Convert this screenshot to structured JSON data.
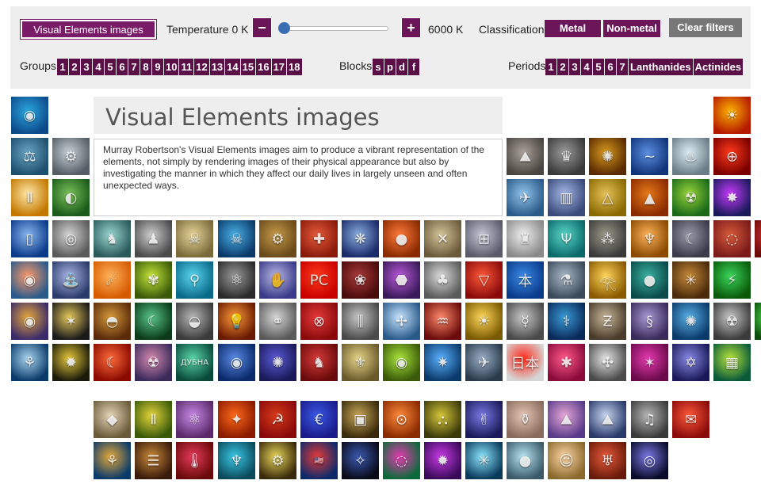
{
  "filters": {
    "ve_button": "Visual Elements images",
    "temperature_label": "Temperature 0 K",
    "minus": "−",
    "plus": "+",
    "temperature_max_label": "6000 K",
    "slider_value": 0,
    "classification_label": "Classification",
    "metal": "Metal",
    "nonmetal": "Non-metal",
    "clear": "Clear filters",
    "groups_label": "Groups",
    "groups": [
      "1",
      "2",
      "3",
      "4",
      "5",
      "6",
      "7",
      "8",
      "9",
      "10",
      "11",
      "12",
      "13",
      "14",
      "15",
      "16",
      "17",
      "18"
    ],
    "blocks_label": "Blocks",
    "blocks": [
      "s",
      "p",
      "d",
      "f"
    ],
    "periods_label": "Periods",
    "periods": [
      "1",
      "2",
      "3",
      "4",
      "5",
      "6",
      "7",
      "Lanthanides",
      "Actinides"
    ]
  },
  "info": {
    "title": "Visual Elements images",
    "description": "Murray Robertson's Visual Elements images aim to produce a vibrant representation of the elements, not simply by rendering images of their physical appearance but also by investigating the manner in which they affect our daily lives in largely unseen and often unexpected ways."
  },
  "tiles": [
    {
      "period": 1,
      "group": 1,
      "c1": "#0d4a8a",
      "c2": "#2aa7e0",
      "icon": "◉"
    },
    {
      "period": 1,
      "group": 18,
      "c1": "#b31a00",
      "c2": "#ffb300",
      "icon": "☀"
    },
    {
      "period": 2,
      "group": 1,
      "c1": "#1d4f6e",
      "c2": "#6aa6c4",
      "icon": "⚖"
    },
    {
      "period": 2,
      "group": 2,
      "c1": "#555e66",
      "c2": "#c9d1d8",
      "icon": "⚙"
    },
    {
      "period": 2,
      "group": 13,
      "c1": "#4a4540",
      "c2": "#a9a39a",
      "icon": "⛰"
    },
    {
      "period": 2,
      "group": 14,
      "c1": "#3a3a3a",
      "c2": "#9c9c9c",
      "icon": "♛"
    },
    {
      "period": 2,
      "group": 15,
      "c1": "#5a2a00",
      "c2": "#d79a20",
      "icon": "✺"
    },
    {
      "period": 2,
      "group": 16,
      "c1": "#12357a",
      "c2": "#5a8ee0",
      "icon": "~"
    },
    {
      "period": 2,
      "group": 17,
      "c1": "#6a7d88",
      "c2": "#dfeef5",
      "icon": "♨"
    },
    {
      "period": 2,
      "group": 18,
      "c1": "#7a0000",
      "c2": "#ff3a1a",
      "icon": "⊕"
    },
    {
      "period": 3,
      "group": 1,
      "c1": "#c47800",
      "c2": "#ffe9a8",
      "icon": "Ⅱ"
    },
    {
      "period": 3,
      "group": 2,
      "c1": "#1a5a1a",
      "c2": "#7ac25a",
      "icon": "◐"
    },
    {
      "period": 3,
      "group": 13,
      "c1": "#2a5a8a",
      "c2": "#8fc4ea",
      "icon": "✈"
    },
    {
      "period": 3,
      "group": 14,
      "c1": "#3a4a7a",
      "c2": "#a3b7e6",
      "icon": "▥"
    },
    {
      "period": 3,
      "group": 15,
      "c1": "#8a6a00",
      "c2": "#e6c25a",
      "icon": "△"
    },
    {
      "period": 3,
      "group": 16,
      "c1": "#8a2a00",
      "c2": "#e67a1a",
      "icon": "▲"
    },
    {
      "period": 3,
      "group": 17,
      "c1": "#1a6a1a",
      "c2": "#9ad63a",
      "icon": "☢"
    },
    {
      "period": 3,
      "group": 18,
      "c1": "#1a1a5a",
      "c2": "#c83aff",
      "icon": "✸"
    },
    {
      "period": 4,
      "group": 1,
      "c1": "#0a3a8a",
      "c2": "#8ab8f0",
      "icon": "▯"
    },
    {
      "period": 4,
      "group": 2,
      "c1": "#5a5a5a",
      "c2": "#d6d6d6",
      "icon": "◎"
    },
    {
      "period": 4,
      "group": 3,
      "c1": "#2a5a5a",
      "c2": "#9ad6d0",
      "icon": "♞"
    },
    {
      "period": 4,
      "group": 4,
      "c1": "#4a4a4a",
      "c2": "#cfcfcf",
      "icon": "♟"
    },
    {
      "period": 4,
      "group": 5,
      "c1": "#7a6a3a",
      "c2": "#e6d69a",
      "icon": "☠"
    },
    {
      "period": 4,
      "group": 6,
      "c1": "#0a3a6a",
      "c2": "#4ab0e6",
      "icon": "☠"
    },
    {
      "period": 4,
      "group": 7,
      "c1": "#6a4a1a",
      "c2": "#c69a4a",
      "icon": "⚙"
    },
    {
      "period": 4,
      "group": 8,
      "c1": "#8a1a0a",
      "c2": "#e65a3a",
      "icon": "✚"
    },
    {
      "period": 4,
      "group": 9,
      "c1": "#1a2a6a",
      "c2": "#8ab0e0",
      "icon": "❋"
    },
    {
      "period": 4,
      "group": 10,
      "c1": "#8a2a00",
      "c2": "#ff7a3a",
      "icon": "●"
    },
    {
      "period": 4,
      "group": 11,
      "c1": "#6a5a3a",
      "c2": "#d6c69a",
      "icon": "✕"
    },
    {
      "period": 4,
      "group": 12,
      "c1": "#5a5a6a",
      "c2": "#c8c8d8",
      "icon": "⊞"
    },
    {
      "period": 4,
      "group": 13,
      "c1": "#8a8a8a",
      "c2": "#f0f0f0",
      "icon": "♜"
    },
    {
      "period": 4,
      "group": 14,
      "c1": "#0a6a6a",
      "c2": "#5ad6c8",
      "icon": "Ψ"
    },
    {
      "period": 4,
      "group": 15,
      "c1": "#3a3a3a",
      "c2": "#9a9a8a",
      "icon": "⁂"
    },
    {
      "period": 4,
      "group": 16,
      "c1": "#8a4a00",
      "c2": "#ffb35a",
      "icon": "♆"
    },
    {
      "period": 4,
      "group": 17,
      "c1": "#3a3a4a",
      "c2": "#9a9aaa",
      "icon": "☾"
    },
    {
      "period": 4,
      "group": 18,
      "c1": "#7a1a1a",
      "c2": "#d65a3a",
      "icon": "◌"
    },
    {
      "period": 4,
      "group": 19,
      "c1": "#6a0a0a",
      "c2": "#e63a3a",
      "icon": "◍"
    },
    {
      "period": 5,
      "group": 1,
      "c1": "#2a5a8a",
      "c2": "#ff9a6a",
      "icon": "◉"
    },
    {
      "period": 5,
      "group": 2,
      "c1": "#2a3a6a",
      "c2": "#aab8e6",
      "icon": "⛲"
    },
    {
      "period": 5,
      "group": 3,
      "c1": "#d65a00",
      "c2": "#ffb35a",
      "icon": "☄"
    },
    {
      "period": 5,
      "group": 4,
      "c1": "#3a5a0a",
      "c2": "#c6e63a",
      "icon": "✾"
    },
    {
      "period": 5,
      "group": 5,
      "c1": "#0a6a8a",
      "c2": "#5ad6f0",
      "icon": "⚲"
    },
    {
      "period": 5,
      "group": 6,
      "c1": "#2a2a2a",
      "c2": "#9a9a9a",
      "icon": "⚛"
    },
    {
      "period": 5,
      "group": 7,
      "c1": "#3a3a8a",
      "c2": "#b8b8e6",
      "icon": "✋"
    },
    {
      "period": 5,
      "group": 8,
      "c1": "#c80000",
      "c2": "#ff3a1a",
      "icon": "РС"
    },
    {
      "period": 5,
      "group": 9,
      "c1": "#4a0a0a",
      "c2": "#a83a3a",
      "icon": "❀"
    },
    {
      "period": 5,
      "group": 10,
      "c1": "#3a1a5a",
      "c2": "#b85ad6",
      "icon": "⬣"
    },
    {
      "period": 5,
      "group": 11,
      "c1": "#5a5a5a",
      "c2": "#dcdcdc",
      "icon": "♣"
    },
    {
      "period": 5,
      "group": 12,
      "c1": "#8a0a0a",
      "c2": "#ff5a3a",
      "icon": "▽"
    },
    {
      "period": 5,
      "group": 13,
      "c1": "#0a3a8a",
      "c2": "#3a8ae6",
      "icon": "本"
    },
    {
      "period": 5,
      "group": 14,
      "c1": "#3a4a5a",
      "c2": "#aabac8",
      "icon": "⚗"
    },
    {
      "period": 5,
      "group": 15,
      "c1": "#8a5a00",
      "c2": "#ffd65a",
      "icon": "𓂀"
    },
    {
      "period": 5,
      "group": 16,
      "c1": "#0a4a4a",
      "c2": "#3ab0a0",
      "icon": "●"
    },
    {
      "period": 5,
      "group": 17,
      "c1": "#4a2a0a",
      "c2": "#c68a3a",
      "icon": "✳"
    },
    {
      "period": 5,
      "group": 18,
      "c1": "#0a5a0a",
      "c2": "#3ad65a",
      "icon": "⚡"
    },
    {
      "period": 6,
      "group": 1,
      "c1": "#3a2a6a",
      "c2": "#e6a83a",
      "icon": "◉"
    },
    {
      "period": 6,
      "group": 2,
      "c1": "#1a1a1a",
      "c2": "#e6c85a",
      "icon": "✶"
    },
    {
      "period": 6,
      "group": 3,
      "c1": "#5a2a0a",
      "c2": "#d69a3a",
      "icon": "◓"
    },
    {
      "period": 6,
      "group": 4,
      "c1": "#0a3a1a",
      "c2": "#5ac68a",
      "icon": "☾"
    },
    {
      "period": 6,
      "group": 5,
      "c1": "#3a3a3a",
      "c2": "#b8b8b8",
      "icon": "◒"
    },
    {
      "period": 6,
      "group": 6,
      "c1": "#6a1a00",
      "c2": "#ff9a3a",
      "icon": "💡"
    },
    {
      "period": 6,
      "group": 7,
      "c1": "#5a5a5a",
      "c2": "#d6d6d6",
      "icon": "⚭"
    },
    {
      "period": 6,
      "group": 8,
      "c1": "#8a0a0a",
      "c2": "#e63a3a",
      "icon": "⊗"
    },
    {
      "period": 6,
      "group": 9,
      "c1": "#4a4a4a",
      "c2": "#c8c8c8",
      "icon": "⫼"
    },
    {
      "period": 6,
      "group": 10,
      "c1": "#2a5a8a",
      "c2": "#c8e6ff",
      "icon": "✢"
    },
    {
      "period": 6,
      "group": 11,
      "c1": "#6a0a0a",
      "c2": "#ff8a6a",
      "icon": "♒"
    },
    {
      "period": 6,
      "group": 12,
      "c1": "#7a5a00",
      "c2": "#ffd65a",
      "icon": "☀"
    },
    {
      "period": 6,
      "group": 13,
      "c1": "#4a4a4a",
      "c2": "#cacaca",
      "icon": "☿"
    },
    {
      "period": 6,
      "group": 14,
      "c1": "#0a2a5a",
      "c2": "#3a9ad6",
      "icon": "⚕"
    },
    {
      "period": 6,
      "group": 15,
      "c1": "#4a3a2a",
      "c2": "#c6b89a",
      "icon": "Ƶ"
    },
    {
      "period": 6,
      "group": 16,
      "c1": "#3a2a5a",
      "c2": "#a89ad6",
      "icon": "§"
    },
    {
      "period": 6,
      "group": 17,
      "c1": "#0a3a6a",
      "c2": "#5ab0e6",
      "icon": "✺"
    },
    {
      "period": 6,
      "group": 18,
      "c1": "#3a3a3a",
      "c2": "#c8c8c8",
      "icon": "☢"
    },
    {
      "period": 6,
      "group": 19,
      "c1": "#0a4a0a",
      "c2": "#5aff5a",
      "icon": "☢"
    },
    {
      "period": 7,
      "group": 1,
      "c1": "#0a3a6a",
      "c2": "#aad6f0",
      "icon": "⚘"
    },
    {
      "period": 7,
      "group": 2,
      "c1": "#1a1a0a",
      "c2": "#e6c83a",
      "icon": "✹"
    },
    {
      "period": 7,
      "group": 3,
      "c1": "#8a0a00",
      "c2": "#ff6a3a",
      "icon": "☾"
    },
    {
      "period": 7,
      "group": 4,
      "c1": "#3a2a5a",
      "c2": "#d68ab0",
      "icon": "☢"
    },
    {
      "period": 7,
      "group": 5,
      "c1": "#0a4a3a",
      "c2": "#5ad6a8",
      "icon": "ДУБНА"
    },
    {
      "period": 7,
      "group": 6,
      "c1": "#0a2a6a",
      "c2": "#5a8ae6",
      "icon": "◉"
    },
    {
      "period": 7,
      "group": 7,
      "c1": "#1a1a5a",
      "c2": "#5a5ad6",
      "icon": "✺"
    },
    {
      "period": 7,
      "group": 8,
      "c1": "#6a0a0a",
      "c2": "#d63a3a",
      "icon": "♞"
    },
    {
      "period": 7,
      "group": 9,
      "c1": "#6a5a2a",
      "c2": "#e6d68a",
      "icon": "⚜"
    },
    {
      "period": 7,
      "group": 10,
      "c1": "#3a5a0a",
      "c2": "#a8e63a",
      "icon": "◉"
    },
    {
      "period": 7,
      "group": 11,
      "c1": "#0a3a6a",
      "c2": "#5ab0ff",
      "icon": "✷"
    },
    {
      "period": 7,
      "group": 12,
      "c1": "#2a3a4a",
      "c2": "#9ab0c8",
      "icon": "✈"
    },
    {
      "period": 7,
      "group": 13,
      "c1": "#d6d6d6",
      "c2": "#ff2a1a",
      "icon": "日本"
    },
    {
      "period": 7,
      "group": 14,
      "c1": "#8a0a3a",
      "c2": "#ff5a8a",
      "icon": "✱"
    },
    {
      "period": 7,
      "group": 15,
      "c1": "#4a4a4a",
      "c2": "#e6e6e6",
      "icon": "✣"
    },
    {
      "period": 7,
      "group": 16,
      "c1": "#6a0a4a",
      "c2": "#e63ab0",
      "icon": "✶"
    },
    {
      "period": 7,
      "group": 17,
      "c1": "#1a1a5a",
      "c2": "#8a8ae6",
      "icon": "✡"
    },
    {
      "period": 7,
      "group": 18,
      "c1": "#0a5a3a",
      "c2": "#b8e63a",
      "icon": "▦"
    },
    {
      "period": 8,
      "group": 3,
      "c1": "#6a5a3a",
      "c2": "#e6d6b8",
      "icon": "◆"
    },
    {
      "period": 8,
      "group": 4,
      "c1": "#3a5a0a",
      "c2": "#e6d63a",
      "icon": "Ⅱ"
    },
    {
      "period": 8,
      "group": 5,
      "c1": "#5a2a6a",
      "c2": "#c88ae6",
      "icon": "⚛"
    },
    {
      "period": 8,
      "group": 6,
      "c1": "#8a1a00",
      "c2": "#ff6a1a",
      "icon": "✦"
    },
    {
      "period": 8,
      "group": 7,
      "c1": "#8a0a0a",
      "c2": "#d63a1a",
      "icon": "☭"
    },
    {
      "period": 8,
      "group": 8,
      "c1": "#1a1a8a",
      "c2": "#3a5ae6",
      "icon": "€"
    },
    {
      "period": 8,
      "group": 9,
      "c1": "#3a2a0a",
      "c2": "#c8a85a",
      "icon": "▣"
    },
    {
      "period": 8,
      "group": 10,
      "c1": "#8a2a00",
      "c2": "#ff8a3a",
      "icon": "⊙"
    },
    {
      "period": 8,
      "group": 11,
      "c1": "#3a3a0a",
      "c2": "#d6c63a",
      "icon": "⛬"
    },
    {
      "period": 8,
      "group": 12,
      "c1": "#1a1a5a",
      "c2": "#7a7ae6",
      "icon": "✌"
    },
    {
      "period": 8,
      "group": 13,
      "c1": "#8a6a5a",
      "c2": "#e6c8b8",
      "icon": "⚱"
    },
    {
      "period": 8,
      "group": 14,
      "c1": "#5a3a8a",
      "c2": "#e6a8d6",
      "icon": "⛰"
    },
    {
      "period": 8,
      "group": 15,
      "c1": "#2a3a6a",
      "c2": "#c8d6f0",
      "icon": "⛰"
    },
    {
      "period": 8,
      "group": 16,
      "c1": "#3a3a3a",
      "c2": "#b8b8b8",
      "icon": "♫"
    },
    {
      "period": 8,
      "group": 17,
      "c1": "#8a0a0a",
      "c2": "#ff5a3a",
      "icon": "✉"
    },
    {
      "period": 9,
      "group": 3,
      "c1": "#0a3a6a",
      "c2": "#e6a83a",
      "icon": "⚘"
    },
    {
      "period": 9,
      "group": 4,
      "c1": "#3a1a0a",
      "c2": "#c88a3a",
      "icon": "☰"
    },
    {
      "period": 9,
      "group": 5,
      "c1": "#6a0a0a",
      "c2": "#e63a5a",
      "icon": "🌡"
    },
    {
      "period": 9,
      "group": 6,
      "c1": "#0a4a5a",
      "c2": "#3ac8e6",
      "icon": "♆"
    },
    {
      "period": 9,
      "group": 7,
      "c1": "#3a2a0a",
      "c2": "#e6d65a",
      "icon": "⚙"
    },
    {
      "period": 9,
      "group": 8,
      "c1": "#0a2a6a",
      "c2": "#e63a3a",
      "icon": "🇺🇸"
    },
    {
      "period": 9,
      "group": 9,
      "c1": "#0a0a1a",
      "c2": "#3a5ab0",
      "icon": "✧"
    },
    {
      "period": 9,
      "group": 10,
      "c1": "#0a6a3a",
      "c2": "#e63ab0",
      "icon": "◌"
    },
    {
      "period": 9,
      "group": 11,
      "c1": "#3a0a5a",
      "c2": "#c83ae6",
      "icon": "✹"
    },
    {
      "period": 9,
      "group": 12,
      "c1": "#0a3a5a",
      "c2": "#8ae6ff",
      "icon": "✳"
    },
    {
      "period": 9,
      "group": 13,
      "c1": "#3a5a6a",
      "c2": "#b8e6f0",
      "icon": "●"
    },
    {
      "period": 9,
      "group": 14,
      "c1": "#8a6a2a",
      "c2": "#ffd6a8",
      "icon": "☺"
    },
    {
      "period": 9,
      "group": 15,
      "c1": "#6a1a0a",
      "c2": "#e65a3a",
      "icon": "♅"
    },
    {
      "period": 9,
      "group": 16,
      "c1": "#0a0a2a",
      "c2": "#7a7ae6",
      "icon": "◎"
    }
  ]
}
